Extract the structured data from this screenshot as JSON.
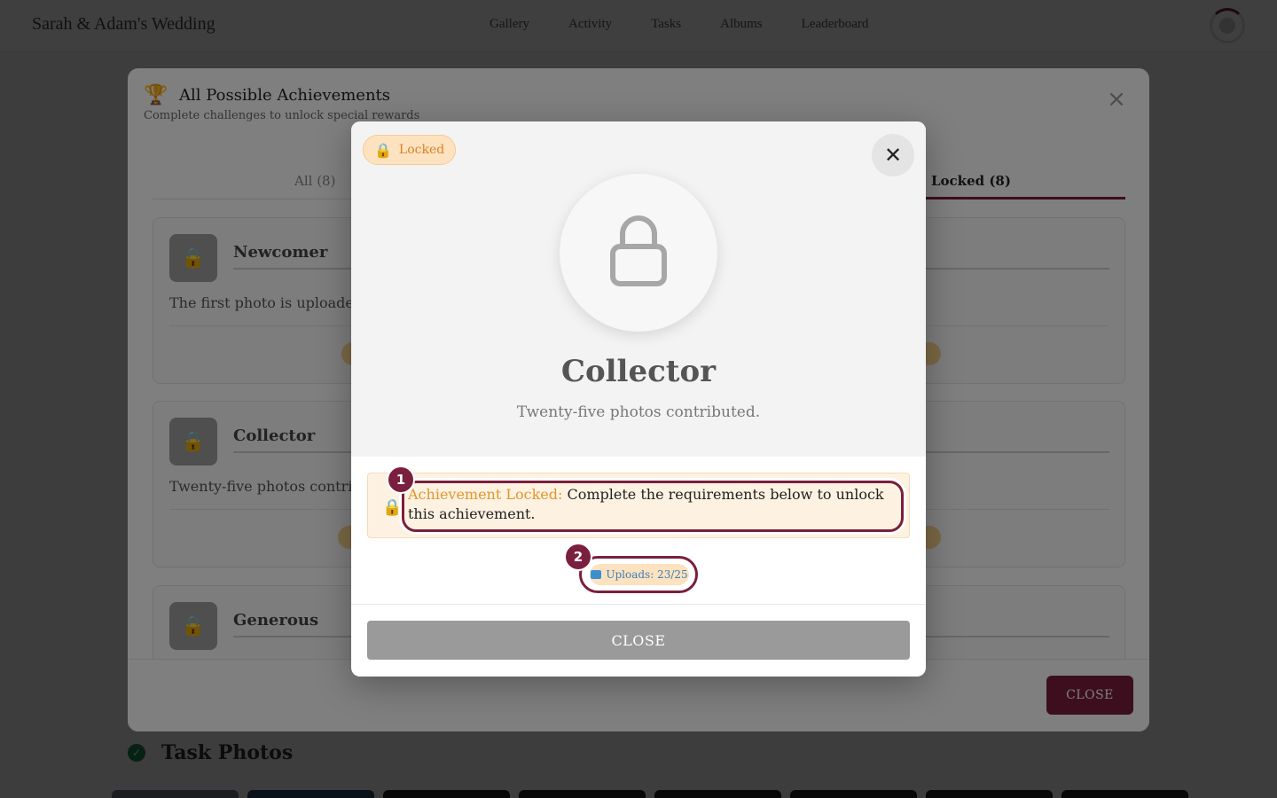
{
  "app": {
    "brand": "Sarah & Adam's Wedding",
    "nav": [
      "Gallery",
      "Activity",
      "Tasks",
      "Albums",
      "Leaderboard"
    ]
  },
  "page": {
    "section_title": "Task Photos"
  },
  "achievements_modal": {
    "title": "All Possible Achievements",
    "subtitle": "Complete challenges to unlock special rewards",
    "tabs": {
      "all": "All (8)",
      "locked": "Locked (8)"
    },
    "cards": [
      {
        "name": "Newcomer",
        "description": "The first photo is uploaded -"
      },
      {
        "name": "Collector",
        "description": "Twenty-five photos contribu"
      },
      {
        "name": "Generous",
        "description": ""
      }
    ],
    "close_label": "CLOSE"
  },
  "detail_modal": {
    "status_badge": "Locked",
    "title": "Collector",
    "description": "Twenty-five photos contributed.",
    "notice_label": "Achievement Locked:",
    "notice_text": " Complete the requirements below to unlock this achievement.",
    "requirement": "Uploads: 23/25",
    "close_label": "CLOSE",
    "annotations": [
      "1",
      "2"
    ],
    "colors": {
      "accent": "#7a1f3d",
      "locked_text": "#d9822b"
    }
  }
}
